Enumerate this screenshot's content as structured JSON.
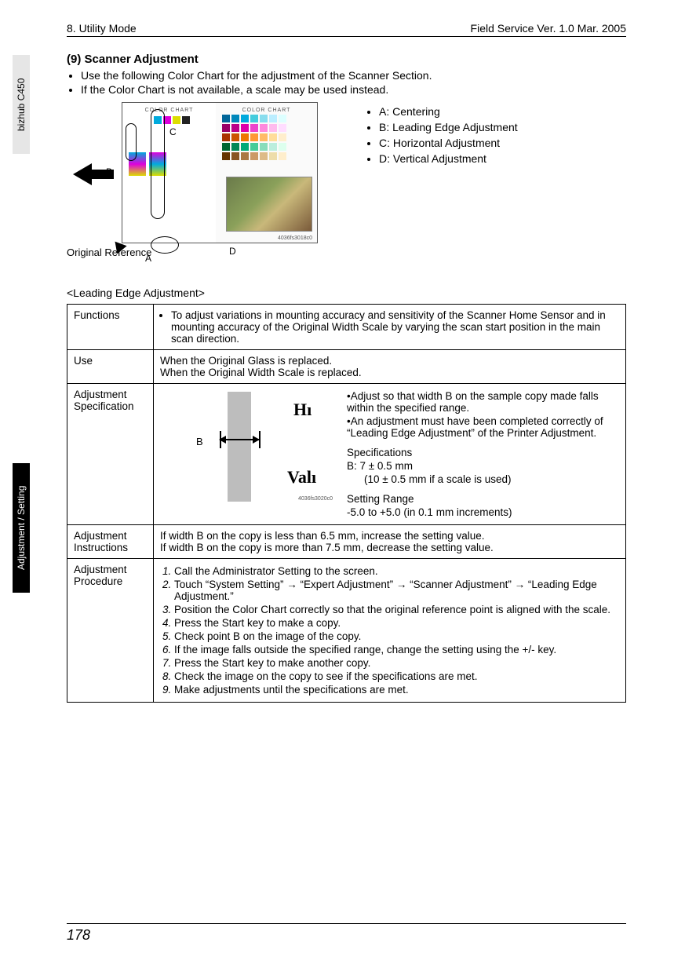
{
  "header": {
    "left": "8. Utility Mode",
    "right": "Field Service Ver. 1.0 Mar. 2005"
  },
  "side": {
    "model": "bizhub C450",
    "section": "Adjustment / Setting"
  },
  "title": "(9)   Scanner Adjustment",
  "intro": [
    "Use the following Color Chart for the adjustment of the Scanner Section.",
    "If the Color Chart is not available, a scale may be used instead."
  ],
  "legend": {
    "a": "A: Centering",
    "b": "B: Leading Edge Adjustment",
    "c": "C: Horizontal Adjustment",
    "d": "D: Vertical Adjustment"
  },
  "diagram": {
    "chartTitle": "COLOR   CHART",
    "markers": {
      "a": "A",
      "b": "B",
      "c": "C",
      "d": "D"
    },
    "figref": "4036fs3018c0",
    "origRef": "Original Reference"
  },
  "subheading": "<Leading Edge Adjustment>",
  "table": {
    "functions": {
      "label": "Functions",
      "text": "To adjust variations in mounting accuracy and sensitivity of the Scanner Home Sensor and in mounting accuracy of the Original Width Scale by varying the scan start position in the main scan direction."
    },
    "use": {
      "label": "Use",
      "l1": "When the Original Glass is replaced.",
      "l2": "When the Original Width Scale is replaced."
    },
    "spec": {
      "label": "Adjustment Specification",
      "fig": {
        "b": "B",
        "hl": "Hı",
        "vl": "Valı",
        "fignum": "4036fs3020c0"
      },
      "b1": "Adjust so that width B on the sample copy made falls within the specified range.",
      "b2": "An adjustment must have been completed correctly of “Leading Edge Adjustment” of the Printer Adjustment.",
      "specHdr": "Specifications",
      "specVal": "B: 7 ± 0.5 mm",
      "specAlt": "(10 ± 0.5 mm if a scale is used)",
      "rangeHdr": "Setting Range",
      "rangeVal": "-5.0 to +5.0   (in 0.1 mm increments)"
    },
    "instr": {
      "label": "Adjustment Instructions",
      "l1": "If width B on the copy is less than 6.5 mm, increase the setting value.",
      "l2": "If width B on the copy is more than 7.5 mm, decrease the setting value."
    },
    "proc": {
      "label": "Adjustment Procedure",
      "s1": "Call the Administrator Setting to the screen.",
      "s2": "Touch “System Setting” → “Expert Adjustment” → “Scanner Adjustment” → “Leading Edge Adjustment.”",
      "s3": "Position the Color Chart correctly so that the original reference point is aligned with the scale.",
      "s4": "Press the Start key to make a copy.",
      "s5": "Check point B on the image of the copy.",
      "s6": "If the image falls outside the specified range, change the setting using the +/- key.",
      "s7": "Press the Start key to make another copy.",
      "s8": "Check the image on the copy to see if the specifications are met.",
      "s9": "Make adjustments until the specifications are met."
    }
  },
  "footer": {
    "page": "178"
  }
}
